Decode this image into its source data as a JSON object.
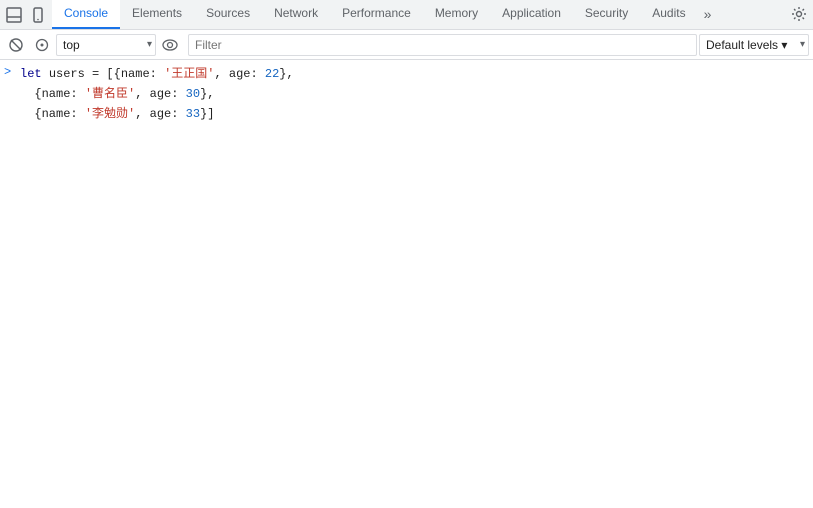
{
  "tabs": [
    {
      "id": "console",
      "label": "Console",
      "active": true
    },
    {
      "id": "elements",
      "label": "Elements",
      "active": false
    },
    {
      "id": "sources",
      "label": "Sources",
      "active": false
    },
    {
      "id": "network",
      "label": "Network",
      "active": false
    },
    {
      "id": "performance",
      "label": "Performance",
      "active": false
    },
    {
      "id": "memory",
      "label": "Memory",
      "active": false
    },
    {
      "id": "application",
      "label": "Application",
      "active": false
    },
    {
      "id": "security",
      "label": "Security",
      "active": false
    },
    {
      "id": "audits",
      "label": "Audits",
      "active": false
    }
  ],
  "toolbar": {
    "context_default": "top",
    "filter_placeholder": "Filter",
    "levels_label": "Default levels"
  },
  "console": {
    "lines": [
      {
        "prompt": ">",
        "parts": [
          {
            "type": "keyword",
            "text": "let "
          },
          {
            "type": "varname",
            "text": "users"
          },
          {
            "type": "operator",
            "text": " = ["
          },
          {
            "type": "bracket",
            "text": "{"
          },
          {
            "type": "property",
            "text": "name: "
          },
          {
            "type": "string",
            "text": "'王正国'"
          },
          {
            "type": "comma",
            "text": ", "
          },
          {
            "type": "property",
            "text": "age: "
          },
          {
            "type": "number",
            "text": "22"
          },
          {
            "type": "bracket",
            "text": "}"
          },
          {
            "type": "comma",
            "text": ","
          }
        ]
      },
      {
        "prompt": "",
        "parts": [
          {
            "type": "bracket",
            "text": "  {"
          },
          {
            "type": "property",
            "text": "name: "
          },
          {
            "type": "string",
            "text": "'曹名臣'"
          },
          {
            "type": "comma",
            "text": ", "
          },
          {
            "type": "property",
            "text": "age: "
          },
          {
            "type": "number",
            "text": "30"
          },
          {
            "type": "bracket",
            "text": "}"
          },
          {
            "type": "comma",
            "text": ","
          }
        ]
      },
      {
        "prompt": "",
        "parts": [
          {
            "type": "bracket",
            "text": "  {"
          },
          {
            "type": "property",
            "text": "name: "
          },
          {
            "type": "string",
            "text": "'李勉勋'"
          },
          {
            "type": "comma",
            "text": ", "
          },
          {
            "type": "property",
            "text": "age: "
          },
          {
            "type": "number",
            "text": "33"
          },
          {
            "type": "bracket",
            "text": "}]"
          }
        ]
      }
    ]
  }
}
